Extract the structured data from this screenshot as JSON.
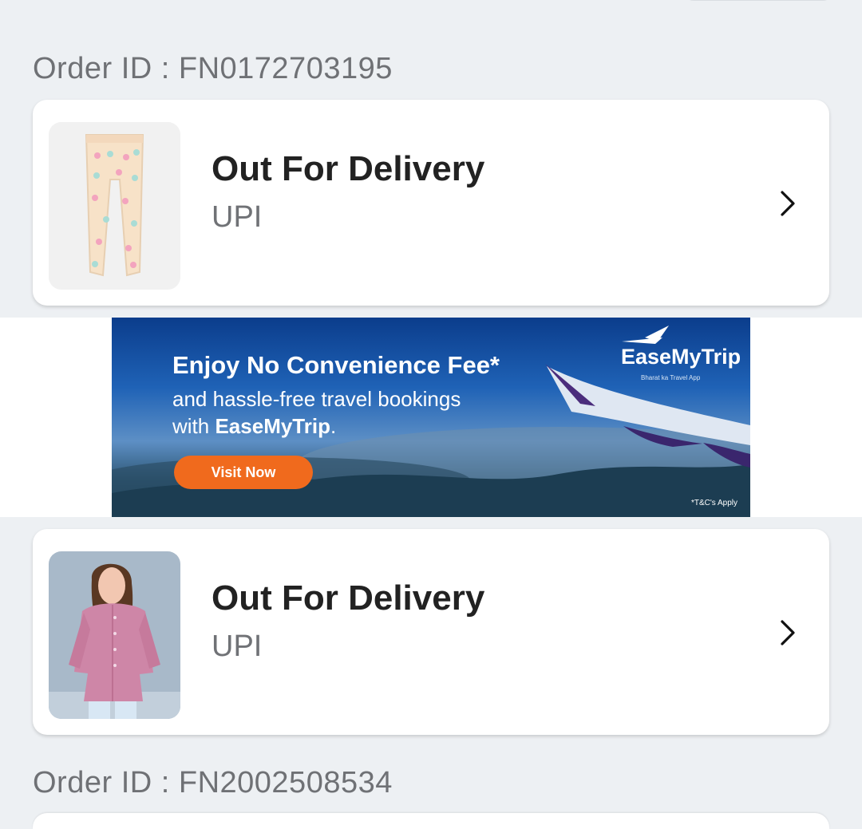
{
  "orders": [
    {
      "order_label": "Order ID : FN0172703195",
      "status": "Out For Delivery",
      "payment": "UPI",
      "chevron_icon": "chevron-right-icon"
    },
    {
      "status": "Out For Delivery",
      "payment": "UPI",
      "chevron_icon": "chevron-right-icon"
    },
    {
      "order_label": "Order ID : FN2002508534"
    }
  ],
  "ad": {
    "headline": "Enjoy No Convenience Fee*",
    "line1": "and hassle-free travel bookings",
    "line2_prefix": "with ",
    "line2_brand": "EaseMyTrip",
    "line2_suffix": ".",
    "button": "Visit Now",
    "brand": "EaseMyTrip",
    "brand_sub": "Bharat ka Travel App",
    "tnc": "*T&C's Apply"
  },
  "colors": {
    "page_bg": "#edf0f3",
    "accent_orange": "#f06a1d",
    "text_dark": "#222222",
    "text_muted": "#6f7175"
  }
}
